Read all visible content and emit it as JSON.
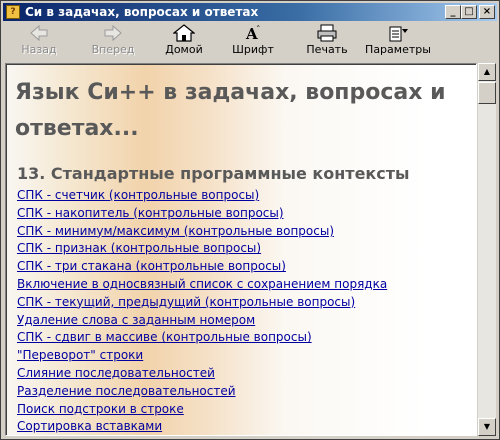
{
  "window": {
    "title": "Си в задачах, вопросах и ответах"
  },
  "toolbar": {
    "back": "Назад",
    "forward": "Вперед",
    "home": "Домой",
    "font": "Шрифт",
    "print": "Печать",
    "options": "Параметры"
  },
  "content": {
    "heading": "Язык Си++ в задачах, вопросах и ответах...",
    "section_title": "13. Стандартные программные контексты",
    "links": [
      "СПК - счетчик (контрольные вопросы)",
      "СПК - накопитель (контрольные вопросы)",
      "СПК - минимум/максимум (контрольные вопросы)",
      "СПК - признак (контрольные вопросы)",
      "СПК - три стакана (контрольные вопросы)",
      "Включение в односвязный список с сохранением порядка",
      "СПК - текущий, предыдущий (контрольные вопросы)",
      "Удаление слова с заданным номером",
      "СПК - сдвиг в массиве (контрольные вопросы)",
      "\"Переворот\" строки",
      "Слияние последовательностей",
      "Разделение последовательностей",
      "Поиск подстроки в строке",
      "Сортировка вставками"
    ]
  }
}
